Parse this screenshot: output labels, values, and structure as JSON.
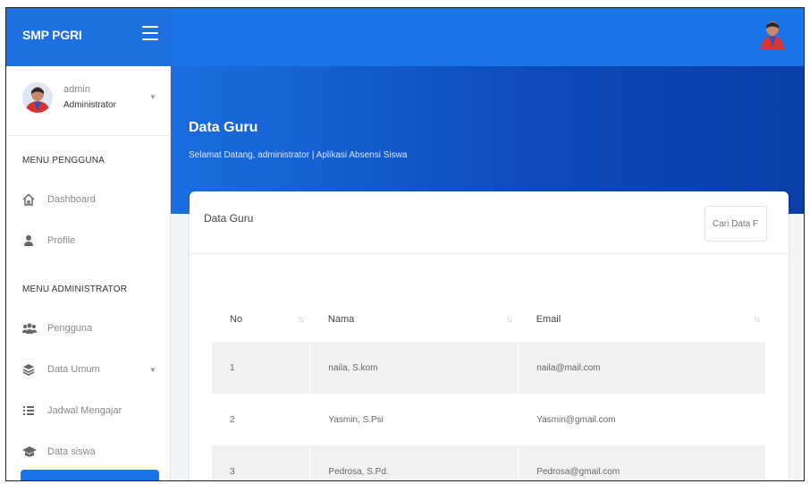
{
  "app": {
    "brand": "SMP PGRI"
  },
  "sidebar": {
    "user": {
      "name": "admin",
      "role": "Administrator"
    },
    "sections": [
      {
        "title": "MENU PENGGUNA"
      },
      {
        "title": "MENU ADMINISTRATOR"
      }
    ],
    "items": [
      {
        "label": "Dashboard",
        "icon": "home-icon"
      },
      {
        "label": "Profile",
        "icon": "user-icon"
      },
      {
        "label": "Pengguna",
        "icon": "users-icon"
      },
      {
        "label": "Data Umum",
        "icon": "layers-icon"
      },
      {
        "label": "Jadwal Mengajar",
        "icon": "list-icon"
      },
      {
        "label": "Data siswa",
        "icon": "graduation-cap-icon"
      }
    ]
  },
  "header": {
    "title": "Data Guru",
    "subtitle": "Selamat Datang, administrator | Aplikasi Absensi Siswa"
  },
  "card": {
    "title": "Data Guru",
    "search_placeholder": "Cari Data F"
  },
  "table": {
    "columns": [
      "No",
      "Nama",
      "Email"
    ],
    "rows": [
      [
        "1",
        "naila, S.kom",
        "naila@mail.com"
      ],
      [
        "2",
        "Yasmin, S.Psi",
        "Yasmin@gmail.com"
      ],
      [
        "3",
        "Pedrosa, S.Pd.",
        "Pedrosa@gmail.com"
      ]
    ]
  },
  "colors": {
    "primary": "#1a73e8",
    "hero_dark": "#0a3ea8"
  }
}
